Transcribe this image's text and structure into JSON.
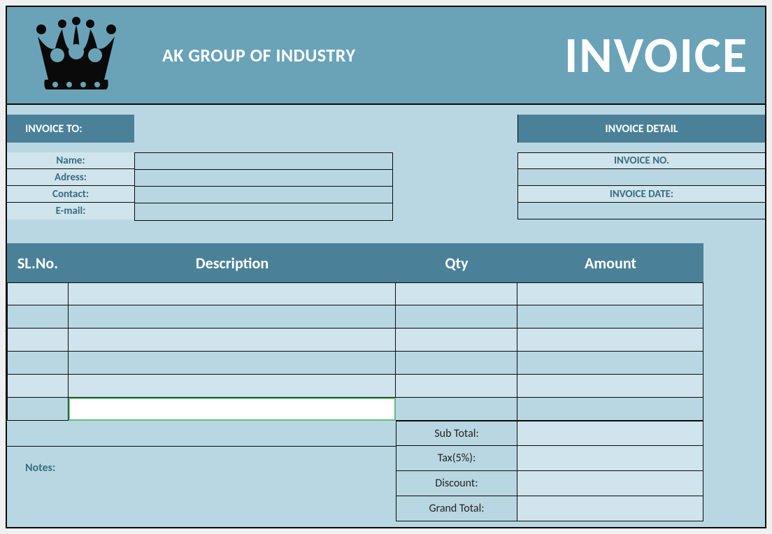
{
  "header": {
    "company": "AK GROUP OF INDUSTRY",
    "title": "INVOICE"
  },
  "invoice_to": {
    "header": "INVOICE TO:",
    "fields": {
      "name_label": "Name:",
      "address_label": "Adress:",
      "contact_label": "Contact:",
      "email_label": "E-mail:"
    },
    "values": {
      "name": "",
      "address": "",
      "contact": "",
      "email": ""
    }
  },
  "invoice_detail": {
    "header": "INVOICE DETAIL",
    "invoice_no_label": "INVOICE NO.",
    "invoice_no": "",
    "invoice_date_label": "INVOICE DATE:",
    "invoice_date": ""
  },
  "items_table": {
    "columns": {
      "sl": "SL.No.",
      "description": "Description",
      "qty": "Qty",
      "amount": "Amount"
    },
    "rows": [
      {
        "sl": "",
        "description": "",
        "qty": "",
        "amount": ""
      },
      {
        "sl": "",
        "description": "",
        "qty": "",
        "amount": ""
      },
      {
        "sl": "",
        "description": "",
        "qty": "",
        "amount": ""
      },
      {
        "sl": "",
        "description": "",
        "qty": "",
        "amount": ""
      },
      {
        "sl": "",
        "description": "",
        "qty": "",
        "amount": ""
      },
      {
        "sl": "",
        "description": "",
        "qty": "",
        "amount": ""
      }
    ]
  },
  "totals": {
    "subtotal_label": "Sub Total:",
    "subtotal": "",
    "tax_label": "Tax(5%):",
    "tax": "",
    "discount_label": "Discount:",
    "discount": "",
    "grand_label": "Grand Total:",
    "grand": ""
  },
  "notes_label": "Notes:"
}
